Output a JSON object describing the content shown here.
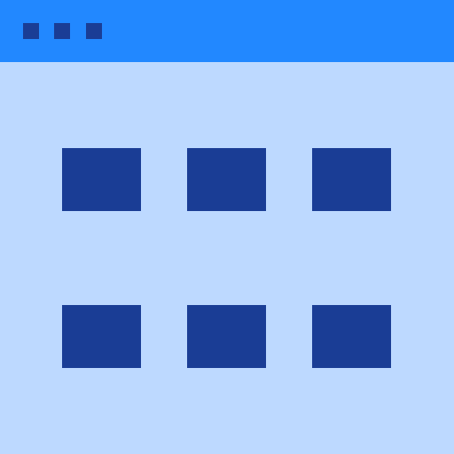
{
  "colors": {
    "titlebar": "#2288ff",
    "content_bg": "#bdd9ff",
    "ink": "#1a3d95"
  },
  "window": {
    "controls": [
      {
        "icon": "window-dot-icon"
      },
      {
        "icon": "window-dot-icon"
      },
      {
        "icon": "window-dot-icon"
      }
    ]
  },
  "grid": {
    "rows": 2,
    "columns": 3,
    "tiles": [
      {
        "icon": "grid-tile"
      },
      {
        "icon": "grid-tile"
      },
      {
        "icon": "grid-tile"
      },
      {
        "icon": "grid-tile"
      },
      {
        "icon": "grid-tile"
      },
      {
        "icon": "grid-tile"
      }
    ]
  }
}
